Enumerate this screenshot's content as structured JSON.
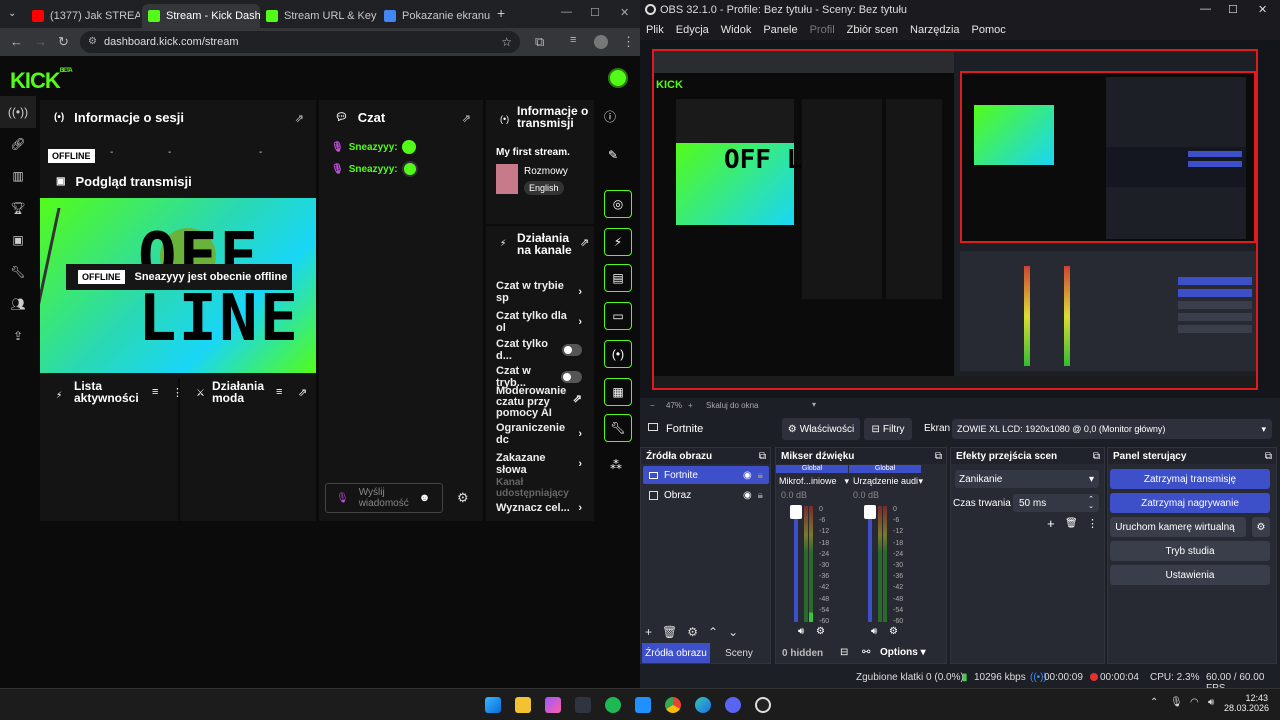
{
  "browser": {
    "tabs": [
      {
        "label": "(1377) Jak STREAM",
        "color": "#ff0000"
      },
      {
        "label": "Stream - Kick Dashl",
        "color": "#53fc18"
      },
      {
        "label": "Stream URL & Key",
        "color": "#53fc18"
      },
      {
        "label": "Pokazanie ekranu",
        "color": "#4285f4"
      }
    ],
    "new_tab": "+",
    "url": "dashboard.kick.com/stream"
  },
  "kick": {
    "logo": "KICK",
    "beta": "BETA",
    "session": {
      "title": "Informacje o sesji",
      "badge": "OFFLINE",
      "stats": [
        "-",
        "-",
        "-"
      ]
    },
    "preview": {
      "title": "Podgląd transmisji",
      "offline_big": "OFF LINE",
      "badge": "OFFLINE",
      "message": "Sneazyyy jest obecnie offline"
    },
    "activity": {
      "title": "Lista aktywności"
    },
    "modactions": {
      "title": "Działania moda"
    },
    "chat": {
      "title": "Czat",
      "messages": [
        {
          "user": "Sneazyyy:"
        },
        {
          "user": "Sneazyyy:"
        }
      ],
      "placeholder": "Wyślij wiadomość"
    },
    "stream_info": {
      "title": "Informacje o transmisji",
      "stream_title": "My first stream.",
      "category": "Rozmowy",
      "language": "English"
    },
    "channel_actions": {
      "title": "Działania na kanale",
      "items": [
        {
          "label": "Czat w trybie sp"
        },
        {
          "label": "Czat tylko dla ol"
        },
        {
          "label": "Czat tylko d..."
        },
        {
          "label": "Czat w tryb..."
        },
        {
          "label": "Moderowanie czatu przy pomocy AI"
        },
        {
          "label": "Ograniczenie dc"
        },
        {
          "label": "Zakazane słowa"
        },
        {
          "label": "Kanał udostępniający"
        },
        {
          "label": "Wyznacz cel..."
        }
      ]
    }
  },
  "obs": {
    "window_title": "OBS 32.1.0 - Profile: Bez tytułu - Sceny: Bez tytułu",
    "menu": [
      "Plik",
      "Edycja",
      "Widok",
      "Panele",
      "Profil",
      "Zbiór scen",
      "Narzędzia",
      "Pomoc"
    ],
    "zoom": "47%",
    "zoom_mode": "Skaluj do okna",
    "source_bar": {
      "name": "Fortnite",
      "properties": "Właściwości",
      "filters": "Filtry",
      "display_label": "Ekran",
      "display_value": "ZOWIE XL LCD: 1920x1080 @ 0,0 (Monitor główny)"
    },
    "sources": {
      "title": "Źródła obrazu",
      "items": [
        {
          "name": "Fortnite"
        },
        {
          "name": "Obraz"
        }
      ],
      "tab_sources": "Źródła obrazu",
      "tab_scenes": "Sceny"
    },
    "mixer": {
      "title": "Mikser dźwięku",
      "channels": [
        {
          "group": "Globał",
          "name": "Mikrof...iniowe",
          "db": "0.0 dB"
        },
        {
          "group": "Globał",
          "name": "Urządzenie audi",
          "db": "0.0 dB"
        }
      ],
      "scale": [
        "0",
        "-6",
        "-12",
        "-18",
        "-24",
        "-30",
        "-36",
        "-42",
        "-48",
        "-54",
        "-60"
      ],
      "hidden": "0 hidden",
      "options": "Options"
    },
    "transitions": {
      "title": "Efekty przejścia scen",
      "value": "Zanikanie",
      "duration_label": "Czas trwania",
      "duration": "50 ms"
    },
    "controls": {
      "title": "Panel sterujący",
      "buttons": [
        "Zatrzymaj transmisję",
        "Zatrzymaj nagrywanie",
        "Uruchom kamerę wirtualną",
        "Tryb studia",
        "Ustawienia"
      ]
    },
    "status": {
      "dropped": "Zgubione klatki 0 (0.0%)",
      "bitrate": "10296 kbps",
      "stream_time": "00:00:09",
      "rec_time": "00:00:04",
      "cpu": "CPU: 2.3%",
      "fps": "60.00 / 60.00 FPS"
    }
  },
  "taskbar": {
    "time": "12:43",
    "date": "28.03.2026"
  }
}
